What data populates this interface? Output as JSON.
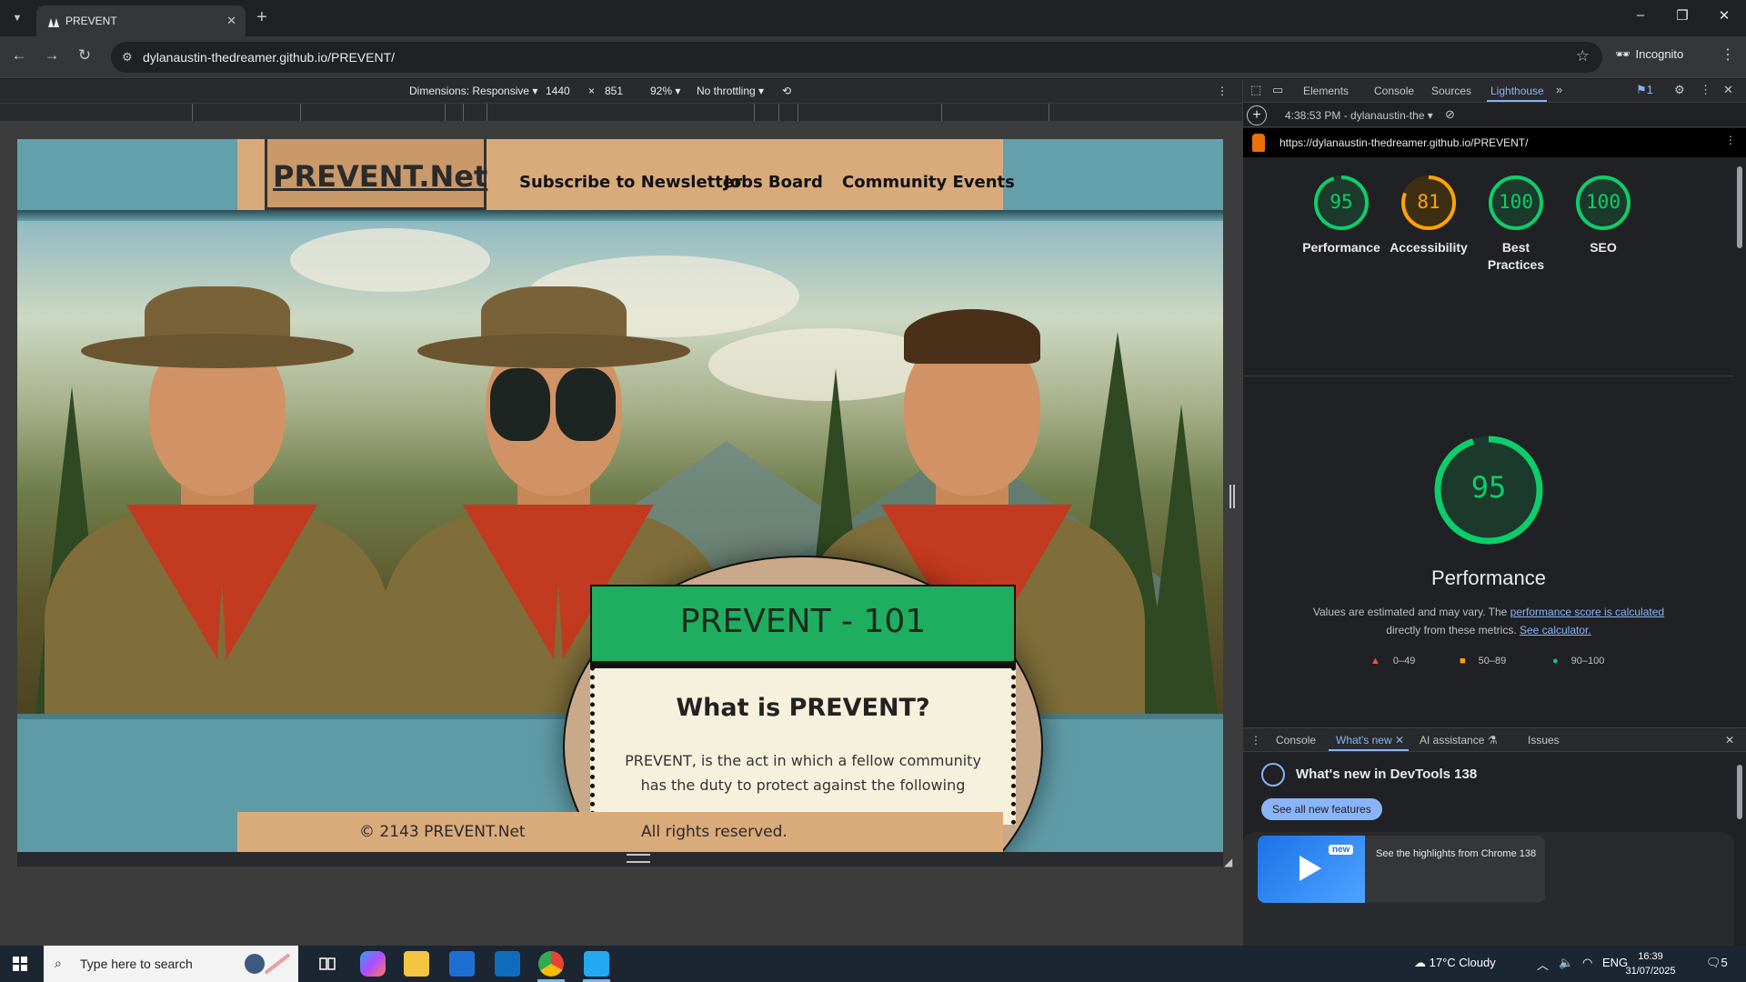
{
  "browser": {
    "tab_title": "PREVENT",
    "url": "dylanaustin-thedreamer.github.io/PREVENT/",
    "profile_label": "Incognito"
  },
  "device_toolbar": {
    "dimensions_label": "Dimensions: Responsive",
    "width": "1440",
    "times": "×",
    "height": "851",
    "zoom": "92%",
    "throttling": "No throttling"
  },
  "site": {
    "logo": "PREVENT.Net",
    "nav": [
      "Subscribe to Newsletter",
      "Jobs Board",
      "Community Events"
    ],
    "banner": "PREVENT - 101",
    "heading": "What is PREVENT?",
    "body": "PREVENT, is the act in which a fellow community has the duty to protect against the following",
    "footer_copy": "© 2143 PREVENT.Net",
    "footer_rights": "All rights reserved."
  },
  "devtools": {
    "tabs": [
      "Elements",
      "Console",
      "Sources",
      "Lighthouse"
    ],
    "active_tab": "Lighthouse",
    "issues_count": "1",
    "report_time": "4:38:53 PM - dylanaustin-the",
    "report_url": "https://dylanaustin-thedreamer.github.io/PREVENT/",
    "scores": [
      {
        "label": "Performance",
        "value": 95,
        "color": "#0cce6b"
      },
      {
        "label": "Accessibility",
        "value": 81,
        "color": "#ffa400"
      },
      {
        "label": "Best Practices",
        "value": 100,
        "color": "#0cce6b"
      },
      {
        "label": "SEO",
        "value": 100,
        "color": "#0cce6b"
      }
    ],
    "main_score": 95,
    "main_title": "Performance",
    "note_prefix": "Values are estimated and may vary. The ",
    "note_link1": "performance score is calculated",
    "note_mid": " directly from these metrics. ",
    "note_link2": "See calculator.",
    "legend": [
      "0–49",
      "50–89",
      "90–100"
    ],
    "legend_colors": [
      "#ff4e42",
      "#ffa400",
      "#0cce6b"
    ]
  },
  "drawer": {
    "tabs": [
      "Console",
      "What's new",
      "AI assistance",
      "Issues"
    ],
    "active_tab": "What's new",
    "title": "What's new in DevTools 138",
    "button": "See all new features",
    "badge": "new",
    "highlight": "See the highlights from Chrome 138"
  },
  "taskbar": {
    "search_placeholder": "Type here to search",
    "weather": "17°C  Cloudy",
    "language": "ENG",
    "time": "16:39",
    "date": "31/07/2025",
    "notif_count": "5"
  }
}
